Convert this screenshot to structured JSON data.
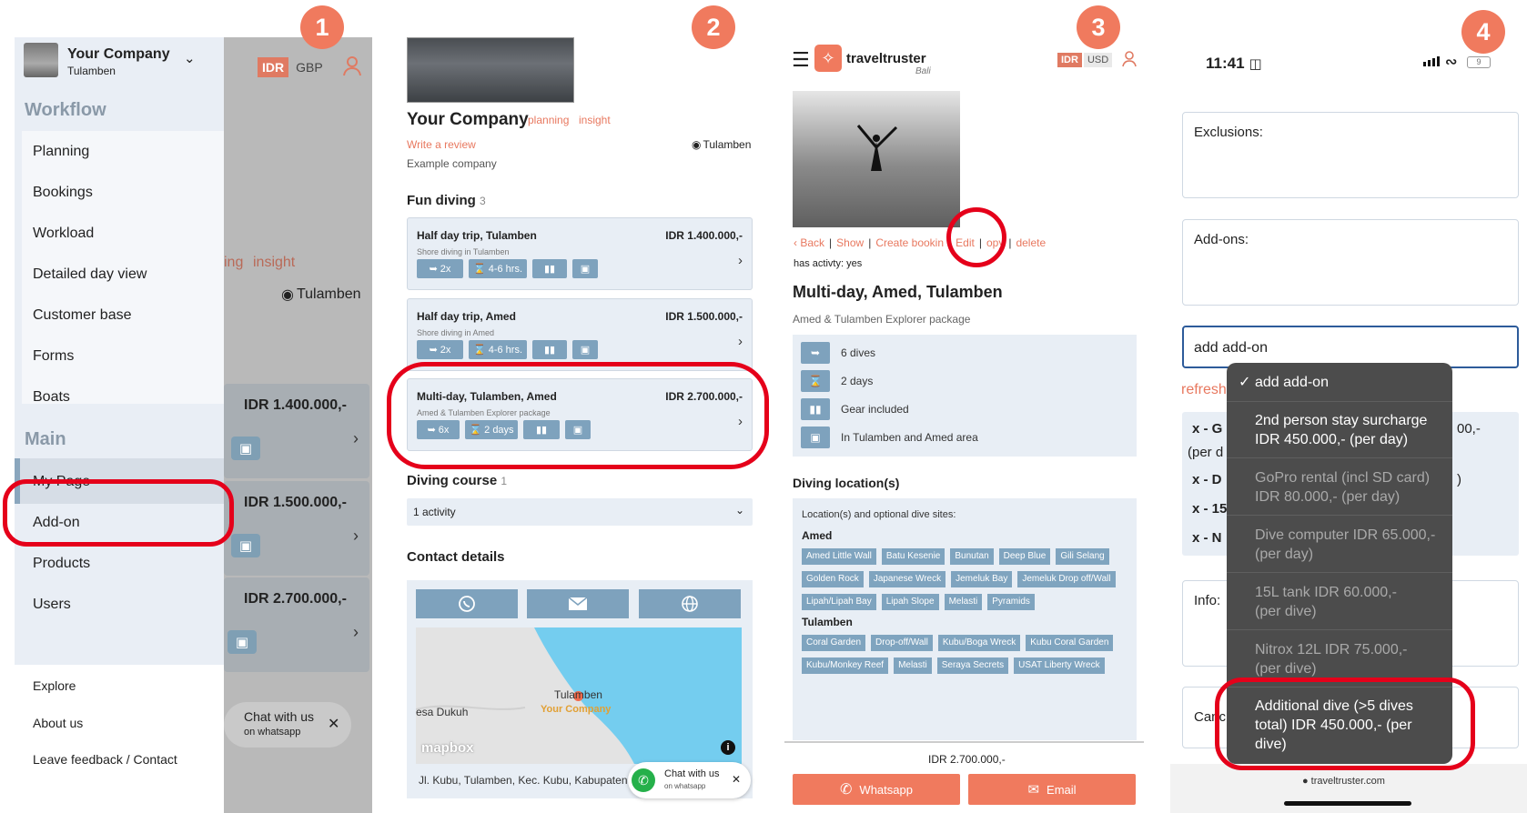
{
  "badges": [
    "1",
    "2",
    "3",
    "4"
  ],
  "panel1": {
    "company_name": "Your Company",
    "company_location": "Tulamben",
    "currency_active": "IDR",
    "currency_other": "GBP",
    "section_workflow": "Workflow",
    "workflow_items": [
      "Planning",
      "Bookings",
      "Workload",
      "Detailed day view",
      "Customer base",
      "Forms",
      "Boats"
    ],
    "section_main": "Main",
    "main_items": [
      "My Page",
      "Add-on",
      "Products",
      "Users"
    ],
    "footer_items": [
      "Explore",
      "About us",
      "Leave feedback / Contact"
    ],
    "bg_tabs": [
      "ing",
      "insight"
    ],
    "bg_location": "Tulamben",
    "bg_prices": [
      "IDR 1.400.000,-",
      "IDR 1.500.000,-",
      "IDR 2.700.000,-"
    ],
    "chat_title": "Chat with us",
    "chat_sub": "on whatsapp"
  },
  "panel2": {
    "company_name": "Your Company",
    "tab_planning": "planning",
    "tab_insight": "insight",
    "write_review": "Write a review",
    "location": "Tulamben",
    "description": "Example company",
    "fun_diving_title": "Fun diving",
    "fun_diving_count": "3",
    "cards": [
      {
        "title": "Half day trip, Tulamben",
        "price": "IDR 1.400.000,-",
        "sub": "Shore diving in Tulamben",
        "dives": "2x",
        "duration": "4-6 hrs."
      },
      {
        "title": "Half day trip, Amed",
        "price": "IDR 1.500.000,-",
        "sub": "Shore diving in Amed",
        "dives": "2x",
        "duration": "4-6 hrs."
      },
      {
        "title": "Multi-day, Tulamben, Amed",
        "price": "IDR 2.700.000,-",
        "sub": "Amed & Tulamben Explorer package",
        "dives": "6x",
        "duration": "2 days"
      }
    ],
    "course_title": "Diving course",
    "course_count": "1",
    "course_select": "1 activity",
    "contact_title": "Contact details",
    "map_place": "Tulamben",
    "map_company": "Your Company",
    "map_dukuh": "esa Dukuh",
    "map_logo": "mapbox",
    "address": "Jl. Kubu, Tulamben, Kec. Kubu, Kabupaten",
    "chat_title": "Chat with us",
    "chat_sub": "on whatsapp"
  },
  "panel3": {
    "brand": "traveltruster",
    "brand_sub": "Bali",
    "currency_active": "IDR",
    "currency_other": "USD",
    "links": [
      "Back",
      "Show",
      "Create bookin",
      "Edit",
      "opy",
      "delete"
    ],
    "has_activity": "has activty: yes",
    "title": "Multi-day, Amed, Tulamben",
    "subtitle": "Amed & Tulamben Explorer package",
    "features": [
      "6 dives",
      "2 days",
      "Gear included",
      "In Tulamben and Amed area"
    ],
    "locations_title": "Diving location(s)",
    "locations_intro": "Location(s) and optional dive sites:",
    "amed_label": "Amed",
    "amed_sites": [
      "Amed Little Wall",
      "Batu Kesenie",
      "Bunutan",
      "Deep Blue",
      "Gili Selang",
      "Golden Rock",
      "Japanese Wreck",
      "Jemeluk Bay",
      "Jemeluk Drop off/Wall",
      "Lipah/Lipah Bay",
      "Lipah Slope",
      "Melasti",
      "Pyramids"
    ],
    "tulamben_label": "Tulamben",
    "tulamben_sites": [
      "Coral Garden",
      "Drop-off/Wall",
      "Kubu/Boga Wreck",
      "Kubu Coral Garden",
      "Kubu/Monkey Reef",
      "Melasti",
      "Seraya Secrets",
      "USAT Liberty Wreck"
    ],
    "price": "IDR 2.700.000,-",
    "whatsapp_btn": "Whatsapp",
    "email_btn": "Email"
  },
  "panel4": {
    "time": "11:41",
    "battery": "9",
    "exclusions_label": "Exclusions:",
    "addons_label": "Add-ons:",
    "select_value": "add add-on",
    "refresh_text": "refresh",
    "bg_rows": [
      "x - G",
      "(per d",
      "x - D",
      "x - 15",
      "x - N"
    ],
    "bg_right": [
      "00,-",
      ")"
    ],
    "info_label": "Info:",
    "cancel_text": "Canc",
    "url": "traveltruster.com",
    "dropdown": [
      {
        "text": "add add-on",
        "checked": true
      },
      {
        "text": "2nd person stay surcharge IDR 450.000,- (per day)"
      },
      {
        "text": "GoPro rental (incl SD card) IDR 80.000,- (per day)"
      },
      {
        "text": "Dive computer IDR 65.000,- (per day)"
      },
      {
        "text": "15L tank IDR 60.000,- (per dive)"
      },
      {
        "text": "Nitrox 12L IDR 75.000,- (per dive)"
      },
      {
        "text": "Additional dive (>5 dives total) IDR 450.000,- (per dive)"
      }
    ]
  },
  "colors": {
    "accent": "#f07a5e",
    "red_ring": "#e5001a",
    "steel_blue": "#7ea2bd",
    "card_bg": "#e8eef5"
  },
  "icons": [
    "chevron-down-icon",
    "user-icon",
    "location-pin-icon",
    "diver-icon",
    "hourglass-icon",
    "gear-icon",
    "bus-icon",
    "whatsapp-icon",
    "mail-icon",
    "globe-icon",
    "hamburger-icon",
    "chevron-right-icon",
    "close-icon",
    "car-icon",
    "signal-icon",
    "wifi-icon",
    "battery-icon",
    "lock-icon",
    "check-icon"
  ]
}
